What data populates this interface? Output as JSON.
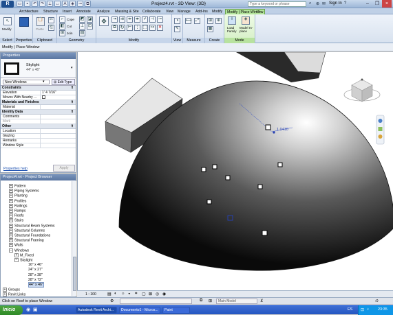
{
  "title_bar": {
    "app_button": "R",
    "window_title": "Project4.rvt - 3D View: {3D}",
    "search_placeholder": "Type a keyword or phrase",
    "signin": "Sign In",
    "help": "?"
  },
  "tabs": [
    "Architecture",
    "Structure",
    "Insert",
    "Annotate",
    "Analyze",
    "Massing & Site",
    "Collaborate",
    "View",
    "Manage",
    "Add-Ins",
    "Modify",
    "Modify | Place Window"
  ],
  "active_tab": "Modify | Place Window",
  "ribbon": {
    "panels": [
      "Select",
      "Properties",
      "Clipboard",
      "Geometry",
      "Modify",
      "View",
      "Measure",
      "Create",
      "Mode"
    ],
    "modify_label": "Modify",
    "paste_label": "Paste",
    "cope_label": "Cope",
    "cut_label": "Cut",
    "join_label": "Join",
    "load_family_label": "Load Family",
    "model_inplace_label": "Model In-place"
  },
  "options_bar": {
    "text": "Modify | Place Window"
  },
  "properties": {
    "header": "Properties",
    "type_name": "Skylight",
    "type_size": "44\" x 46\"",
    "instance_selector": "New Windows",
    "edit_type": "Edit Type",
    "categories": [
      {
        "name": "Constraints",
        "rows": [
          {
            "label": "Elevation",
            "value": "1' 4 7/16\""
          },
          {
            "label": "Moves With Nearby ...",
            "value": ""
          }
        ]
      },
      {
        "name": "Materials and Finishes",
        "rows": [
          {
            "label": "Material",
            "value": ""
          }
        ]
      },
      {
        "name": "Identity Data",
        "rows": [
          {
            "label": "Comments",
            "value": ""
          },
          {
            "label": "Mark",
            "value": ""
          }
        ]
      },
      {
        "name": "Other",
        "rows": [
          {
            "label": "Location",
            "value": ""
          },
          {
            "label": "Glazing",
            "value": ""
          },
          {
            "label": "Remarks",
            "value": ""
          },
          {
            "label": "Window Style",
            "value": ""
          }
        ]
      }
    ],
    "help_link": "Properties help",
    "apply_button": "Apply"
  },
  "project_browser": {
    "header": "Project4.rvt - Project Browser",
    "items": [
      {
        "label": "Pattern",
        "level": 1
      },
      {
        "label": "Piping Systems",
        "level": 1
      },
      {
        "label": "Planting",
        "level": 1
      },
      {
        "label": "Profiles",
        "level": 1
      },
      {
        "label": "Railings",
        "level": 1
      },
      {
        "label": "Ramps",
        "level": 1
      },
      {
        "label": "Roofs",
        "level": 1
      },
      {
        "label": "Stairs",
        "level": 1
      },
      {
        "label": "Structural Beam Systems",
        "level": 1
      },
      {
        "label": "Structural Columns",
        "level": 1
      },
      {
        "label": "Structural Foundations",
        "level": 1
      },
      {
        "label": "Structural Framing",
        "level": 1
      },
      {
        "label": "Walls",
        "level": 1
      },
      {
        "label": "Windows",
        "level": 1
      },
      {
        "label": "M_Fixed",
        "level": 2
      },
      {
        "label": "Skylight",
        "level": 2
      },
      {
        "label": "16\" x 46\"",
        "level": 3
      },
      {
        "label": "24\" x 27\"",
        "level": 3
      },
      {
        "label": "28\" x 38\"",
        "level": 3
      },
      {
        "label": "28\" x 72\"",
        "level": 3
      },
      {
        "label": "44\" x 46\"",
        "level": 3
      },
      {
        "label": "Groups",
        "level": 0
      },
      {
        "label": "Revit Links",
        "level": 0
      }
    ]
  },
  "canvas": {
    "dimension_text": "1.0410"
  },
  "view_bar": {
    "scale": "1 : 100"
  },
  "status_bar": {
    "hint": "Click on Roof to place Window",
    "model": "Main Model",
    "count": ":0"
  },
  "taskbar": {
    "start_label": "Inicio",
    "tasks": [
      "Autodesk Revit Archi...",
      "Documento1 - Micros...",
      "Paint"
    ],
    "lang": "ES",
    "clock": "23:35"
  },
  "colors": {
    "active_tab": "#b2e39a",
    "accent": "#5a76a0",
    "taskbar": "#2456c1"
  }
}
